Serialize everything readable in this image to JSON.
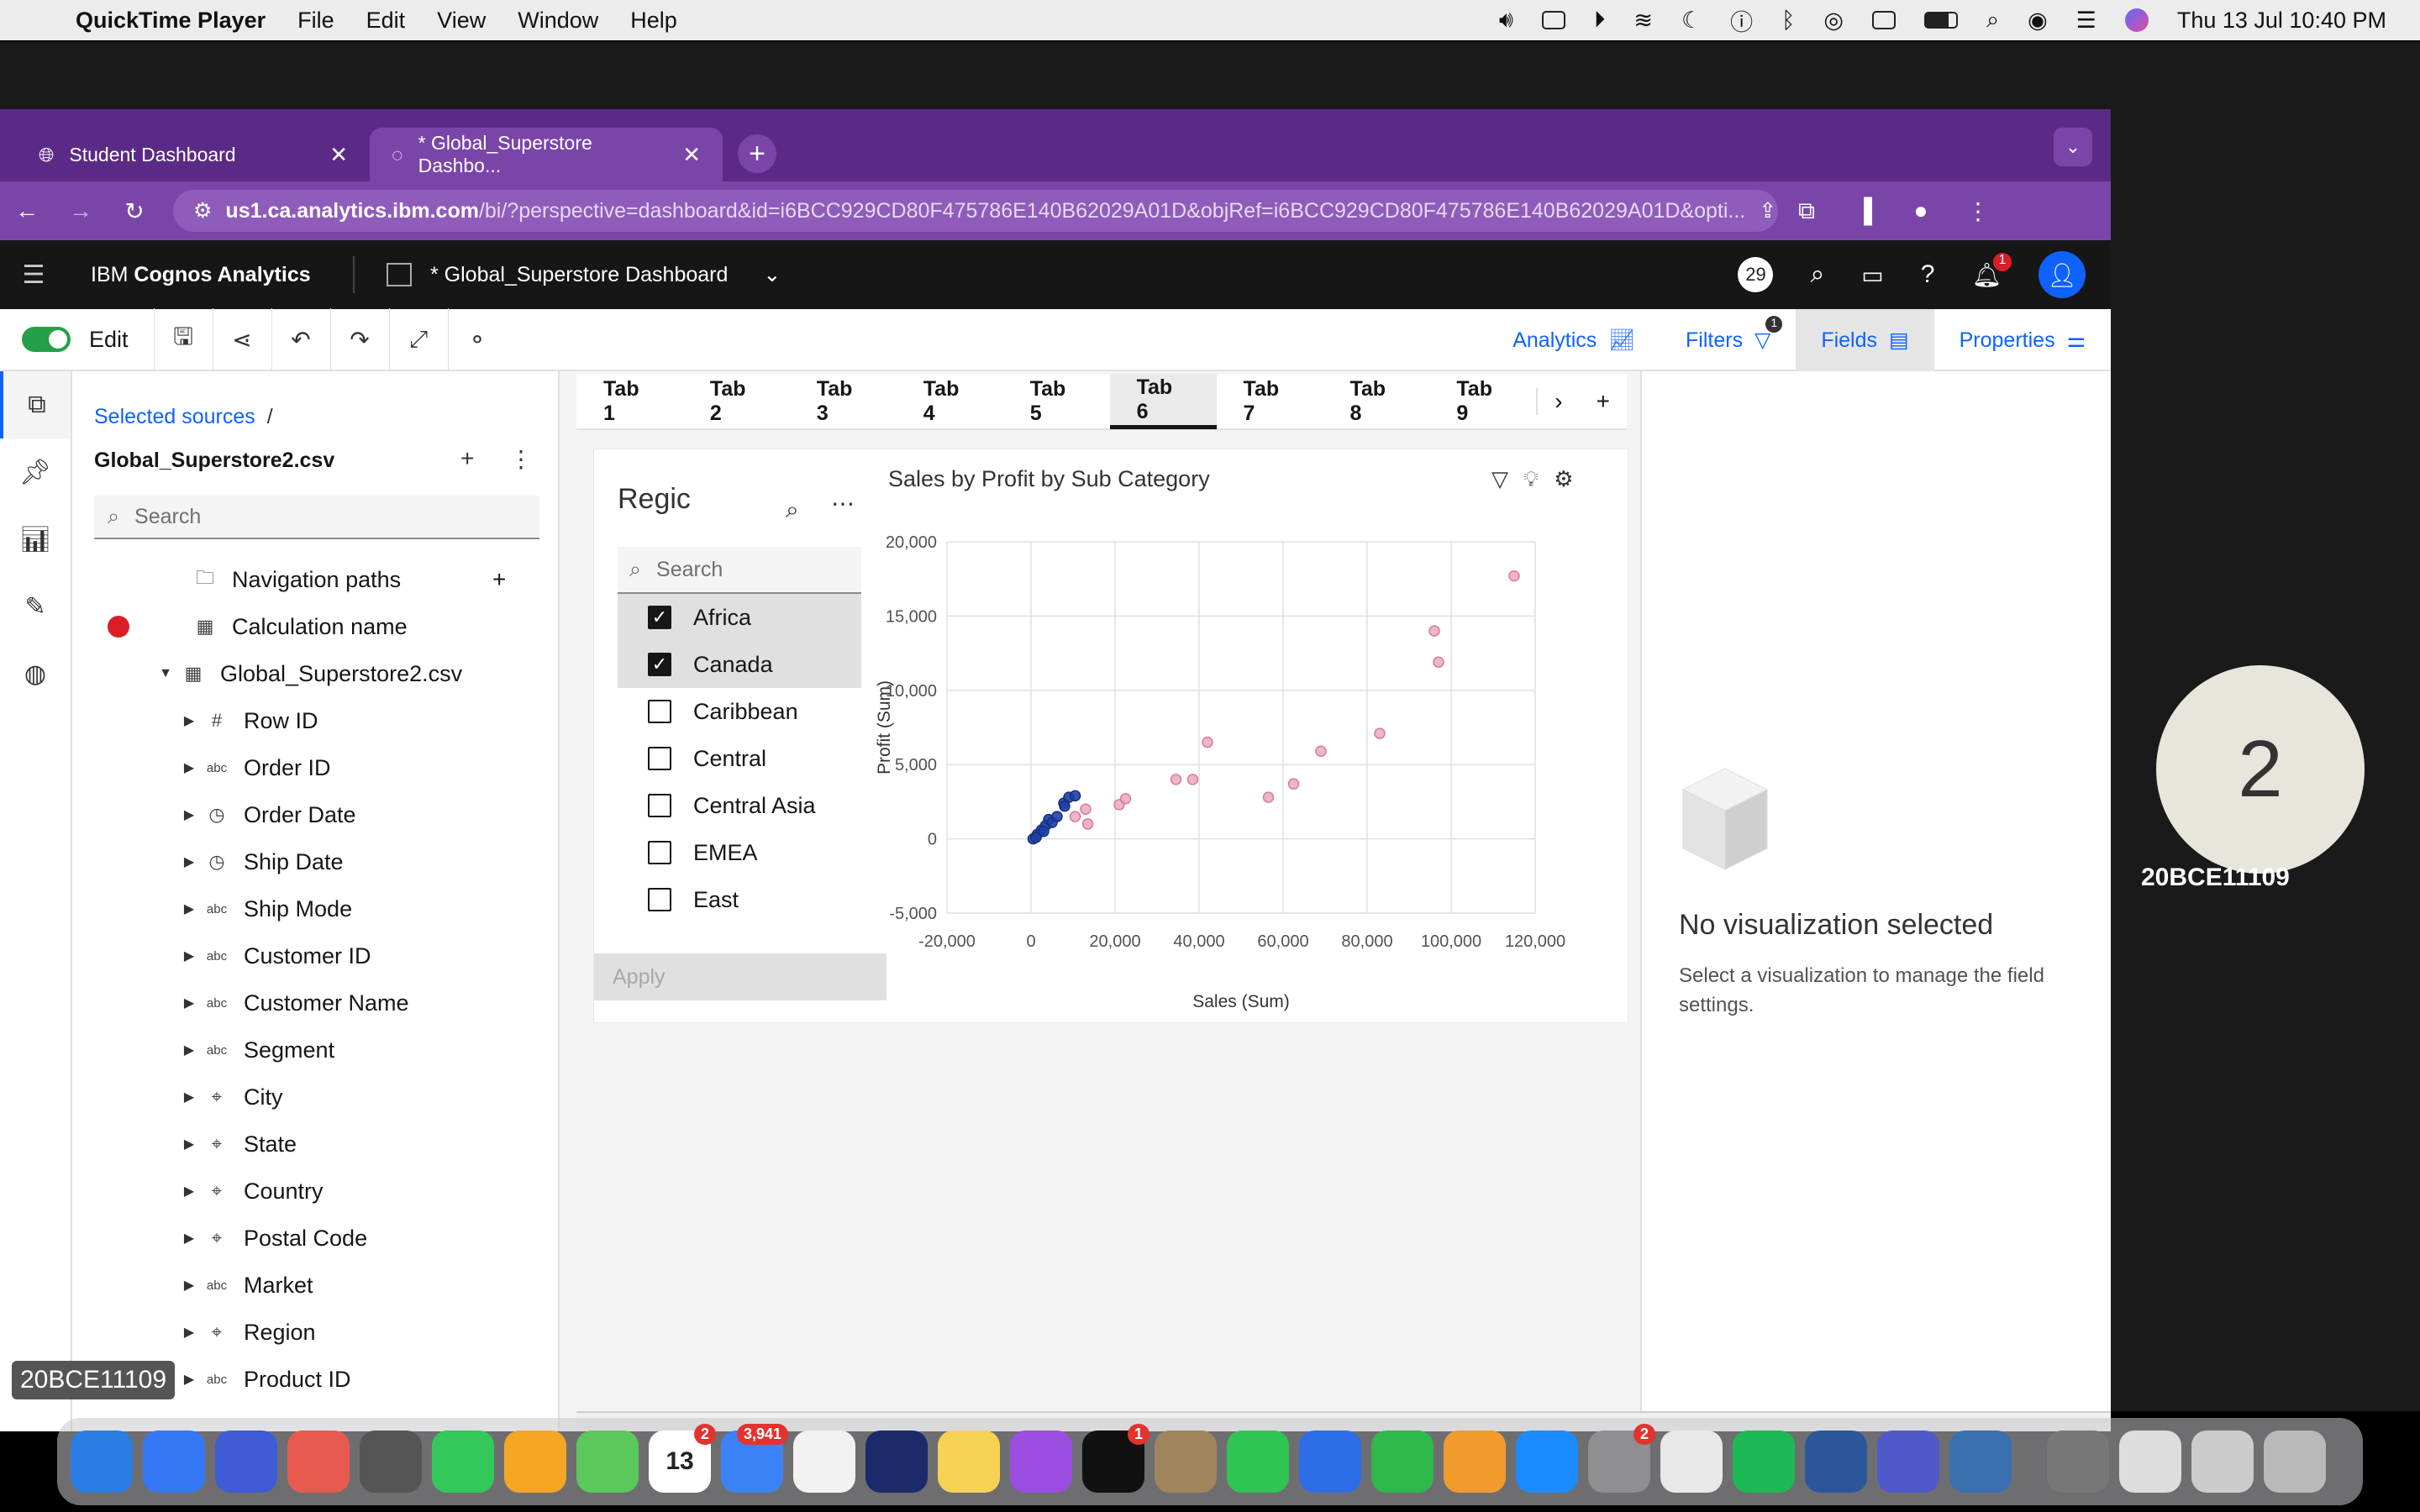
{
  "menubar": {
    "app": "QuickTime Player",
    "items": [
      "File",
      "Edit",
      "View",
      "Window",
      "Help"
    ],
    "datetime": "Thu 13 Jul  10:40 PM"
  },
  "browser": {
    "tabs": [
      {
        "label": "Student Dashboard"
      },
      {
        "label": "* Global_Superstore Dashbo..."
      }
    ],
    "url_host": "us1.ca.analytics.ibm.com",
    "url_path": "/bi/?perspective=dashboard&id=i6BCC929CD80F475786E140B62029A01D&objRef=i6BCC929CD80F475786E140B62029A01D&opti..."
  },
  "cognos": {
    "brand_prefix": "IBM ",
    "brand_name": "Cognos Analytics",
    "dashboard_name": "* Global_Superstore Dashboard",
    "counter": "29",
    "notif_count": "1"
  },
  "toolbar": {
    "edit_label": "Edit",
    "analytics": "Analytics",
    "filters": "Filters",
    "filters_count": "1",
    "fields": "Fields",
    "properties": "Properties"
  },
  "sources": {
    "breadcrumb": "Selected sources",
    "breadcrumb_sep": "/",
    "name": "Global_Superstore2.csv",
    "search_placeholder": "Search",
    "tree": [
      {
        "label": "Navigation paths",
        "icon": "folder-icon",
        "indent": 1
      },
      {
        "label": "Calculation name",
        "icon": "calc-icon",
        "indent": 1
      },
      {
        "label": "Global_Superstore2.csv",
        "icon": "table-icon",
        "indent": 1
      },
      {
        "label": "Row ID",
        "icon": "hash-icon",
        "indent": 2
      },
      {
        "label": "Order ID",
        "icon": "abc-icon",
        "indent": 2
      },
      {
        "label": "Order Date",
        "icon": "clock-icon",
        "indent": 2
      },
      {
        "label": "Ship Date",
        "icon": "clock-icon",
        "indent": 2
      },
      {
        "label": "Ship Mode",
        "icon": "abc-icon",
        "indent": 2
      },
      {
        "label": "Customer ID",
        "icon": "abc-icon",
        "indent": 2
      },
      {
        "label": "Customer Name",
        "icon": "abc-icon",
        "indent": 2
      },
      {
        "label": "Segment",
        "icon": "abc-icon",
        "indent": 2
      },
      {
        "label": "City",
        "icon": "pin-icon",
        "indent": 2
      },
      {
        "label": "State",
        "icon": "pin-icon",
        "indent": 2
      },
      {
        "label": "Country",
        "icon": "pin-icon",
        "indent": 2
      },
      {
        "label": "Postal Code",
        "icon": "pin-icon",
        "indent": 2
      },
      {
        "label": "Market",
        "icon": "abc-icon",
        "indent": 2
      },
      {
        "label": "Region",
        "icon": "pin-icon",
        "indent": 2
      },
      {
        "label": "Product ID",
        "icon": "abc-icon",
        "indent": 2
      }
    ]
  },
  "canvas": {
    "tabs": [
      "Tab 1",
      "Tab 2",
      "Tab 3",
      "Tab 4",
      "Tab 5",
      "Tab 6",
      "Tab 7",
      "Tab 8",
      "Tab 9"
    ],
    "active_tab": "Tab 6"
  },
  "filter": {
    "title": "Regic",
    "search_placeholder": "Search",
    "items": [
      {
        "label": "Africa",
        "checked": true
      },
      {
        "label": "Canada",
        "checked": true
      },
      {
        "label": "Caribbean",
        "checked": false
      },
      {
        "label": "Central",
        "checked": false
      },
      {
        "label": "Central Asia",
        "checked": false
      },
      {
        "label": "EMEA",
        "checked": false
      },
      {
        "label": "East",
        "checked": false
      }
    ],
    "apply": "Apply"
  },
  "chart_data": {
    "type": "scatter",
    "title": "Sales by Profit by Sub Category",
    "xlabel": "Sales (Sum)",
    "ylabel": "Profit (Sum)",
    "xlim": [
      -20000,
      120000
    ],
    "ylim": [
      -5000,
      20000
    ],
    "x_ticks": [
      "-20,000",
      "0",
      "20,000",
      "40,000",
      "60,000",
      "80,000",
      "100,000",
      "120,000"
    ],
    "y_ticks": [
      "20,000",
      "15,000",
      "10,000",
      "5,000",
      "0",
      "-5,000"
    ],
    "grid": true,
    "series": [
      {
        "color": "#1f3fa8",
        "x": [
          500,
          1500,
          2500,
          3500,
          4200,
          5000,
          6200,
          7800,
          9000,
          10500,
          1200,
          3000,
          8000
        ],
        "y": [
          0,
          300,
          600,
          900,
          1300,
          1100,
          1500,
          2400,
          2800,
          2900,
          100,
          500,
          2200
        ]
      },
      {
        "color": "#e89bb5",
        "x": [
          10500,
          13500,
          13000,
          21000,
          22500,
          34500,
          38500,
          42000,
          56500,
          62500,
          69000,
          83000,
          96000,
          97000,
          115000
        ],
        "y": [
          1500,
          1000,
          2000,
          2300,
          2700,
          4000,
          4000,
          6500,
          2800,
          3700,
          5900,
          7100,
          14000,
          11900,
          17700
        ]
      }
    ]
  },
  "rpanel": {
    "title": "No visualization selected",
    "desc": "Select a visualization to manage the field settings."
  },
  "overlay": {
    "participant_number": "2",
    "participant_name": "20BCE11109",
    "watermark": "20BCE11109"
  },
  "dock": {
    "apps": [
      {
        "name": "finder",
        "color": "#2a7de1",
        "badge": ""
      },
      {
        "name": "safari",
        "color": "#3478f6",
        "badge": ""
      },
      {
        "name": "launchpad",
        "color": "#3f5bd6",
        "badge": ""
      },
      {
        "name": "apps",
        "color": "#e85a4f",
        "badge": ""
      },
      {
        "name": "chess",
        "color": "#555555",
        "badge": ""
      },
      {
        "name": "messages",
        "color": "#34c759",
        "badge": ""
      },
      {
        "name": "photos",
        "color": "#f5a623",
        "badge": ""
      },
      {
        "name": "maps",
        "color": "#5ac85a",
        "badge": ""
      },
      {
        "name": "calendar",
        "color": "#ffffff",
        "badge": "2"
      },
      {
        "name": "mail",
        "color": "#3b82f6",
        "badge": "3,941"
      },
      {
        "name": "reminders",
        "color": "#f2f2f2",
        "badge": ""
      },
      {
        "name": "vscode-v",
        "color": "#1b2a6b",
        "badge": ""
      },
      {
        "name": "notes",
        "color": "#f7d154",
        "badge": ""
      },
      {
        "name": "podcasts",
        "color": "#9b4de0",
        "badge": ""
      },
      {
        "name": "tv",
        "color": "#111111",
        "badge": "1"
      },
      {
        "name": "contacts",
        "color": "#a0845c",
        "badge": ""
      },
      {
        "name": "facetime",
        "color": "#30c552",
        "badge": ""
      },
      {
        "name": "keynote",
        "color": "#2d6ee8",
        "badge": ""
      },
      {
        "name": "numbers",
        "color": "#2fb84c",
        "badge": ""
      },
      {
        "name": "pages",
        "color": "#f29b2d",
        "badge": ""
      },
      {
        "name": "appstore",
        "color": "#1a8cff",
        "badge": ""
      },
      {
        "name": "settings",
        "color": "#8e8e93",
        "badge": "2"
      },
      {
        "name": "chrome",
        "color": "#e8e8e8",
        "badge": ""
      },
      {
        "name": "spotify",
        "color": "#1db954",
        "badge": ""
      },
      {
        "name": "word",
        "color": "#2b579a",
        "badge": ""
      },
      {
        "name": "teams",
        "color": "#5059c9",
        "badge": ""
      },
      {
        "name": "quicktime",
        "color": "#3a6fb0",
        "badge": ""
      },
      {
        "name": "window-1",
        "color": "#777777",
        "badge": ""
      },
      {
        "name": "window-2",
        "color": "#dddddd",
        "badge": ""
      },
      {
        "name": "window-3",
        "color": "#cccccc",
        "badge": ""
      },
      {
        "name": "trash",
        "color": "#b9b9b9",
        "badge": ""
      }
    ]
  }
}
